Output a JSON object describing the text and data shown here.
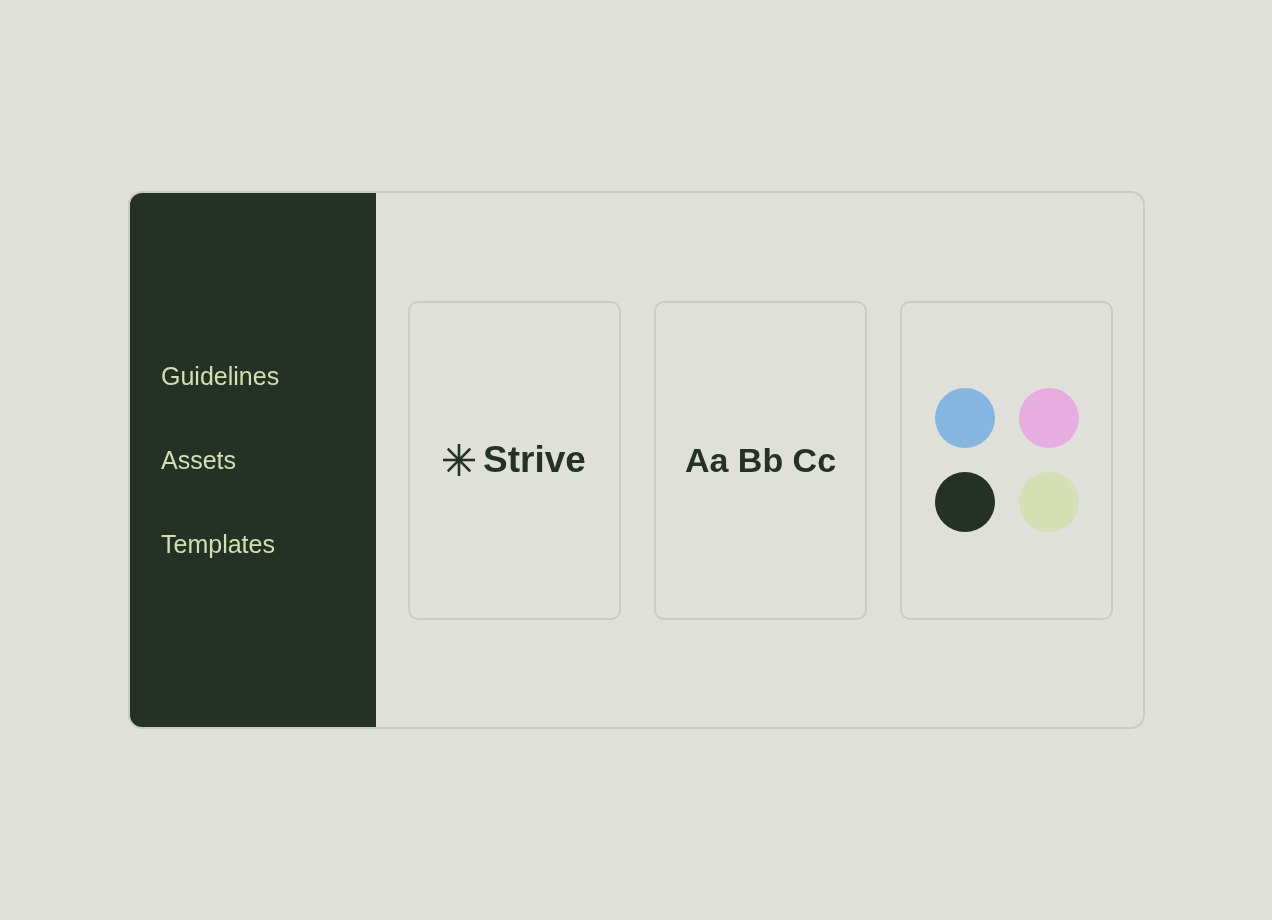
{
  "sidebar": {
    "items": [
      {
        "label": "Guidelines"
      },
      {
        "label": "Assets"
      },
      {
        "label": "Templates"
      }
    ]
  },
  "cards": [
    {
      "kind": "logo",
      "label": "Strive"
    },
    {
      "kind": "type_specimen",
      "label": "Aa Bb Cc"
    },
    {
      "kind": "palette",
      "swatches": [
        {
          "color": "#86b5e0"
        },
        {
          "color": "#e8ade0"
        },
        {
          "color": "#263126"
        },
        {
          "color": "#d5dfb6"
        }
      ]
    }
  ]
}
